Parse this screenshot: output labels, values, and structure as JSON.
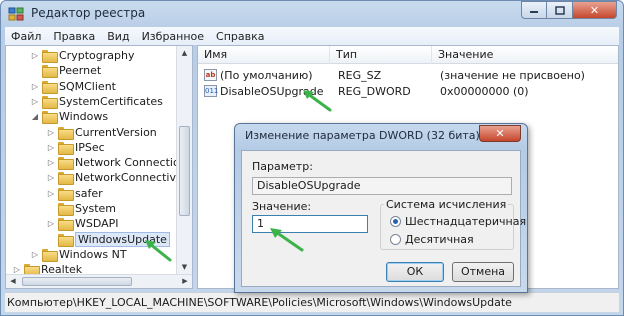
{
  "window": {
    "title": "Редактор реестра"
  },
  "menu": [
    "Файл",
    "Правка",
    "Вид",
    "Избранное",
    "Справка"
  ],
  "tree": [
    {
      "label": "Cryptography",
      "indent": 1,
      "expand": "closed"
    },
    {
      "label": "Peernet",
      "indent": 1,
      "expand": "none"
    },
    {
      "label": "SQMClient",
      "indent": 1,
      "expand": "closed"
    },
    {
      "label": "SystemCertificates",
      "indent": 1,
      "expand": "closed"
    },
    {
      "label": "Windows",
      "indent": 1,
      "expand": "open"
    },
    {
      "label": "CurrentVersion",
      "indent": 2,
      "expand": "closed"
    },
    {
      "label": "IPSec",
      "indent": 2,
      "expand": "closed"
    },
    {
      "label": "Network Connections",
      "indent": 2,
      "expand": "closed"
    },
    {
      "label": "NetworkConnectivityS",
      "indent": 2,
      "expand": "closed"
    },
    {
      "label": "safer",
      "indent": 2,
      "expand": "closed"
    },
    {
      "label": "System",
      "indent": 2,
      "expand": "none"
    },
    {
      "label": "WSDAPI",
      "indent": 2,
      "expand": "closed"
    },
    {
      "label": "WindowsUpdate",
      "indent": 2,
      "expand": "none",
      "selected": true
    },
    {
      "label": "Windows NT",
      "indent": 1,
      "expand": "closed"
    },
    {
      "label": "Realtek",
      "indent": 0,
      "expand": "closed"
    }
  ],
  "list": {
    "columns": [
      "Имя",
      "Тип",
      "Значение"
    ],
    "rows": [
      {
        "icon": "ab",
        "name": "(По умолчанию)",
        "type": "REG_SZ",
        "value": "(значение не присвоено)"
      },
      {
        "icon": "011",
        "name": "DisableOSUpgrade",
        "type": "REG_DWORD",
        "value": "0x00000000 (0)"
      }
    ]
  },
  "dialog": {
    "title": "Изменение параметра DWORD (32 бита)",
    "param_label": "Параметр:",
    "param_value": "DisableOSUpgrade",
    "value_label": "Значение:",
    "value_input": "1",
    "base_label": "Система исчисления",
    "radio_hex": "Шестнадцатеричная",
    "radio_dec": "Десятичная",
    "ok": "ОК",
    "cancel": "Отмена"
  },
  "status": "Компьютер\\HKEY_LOCAL_MACHINE\\SOFTWARE\\Policies\\Microsoft\\Windows\\WindowsUpdate",
  "colors": {
    "annotation": "#3cb34a",
    "selection": "#dce8f7"
  }
}
